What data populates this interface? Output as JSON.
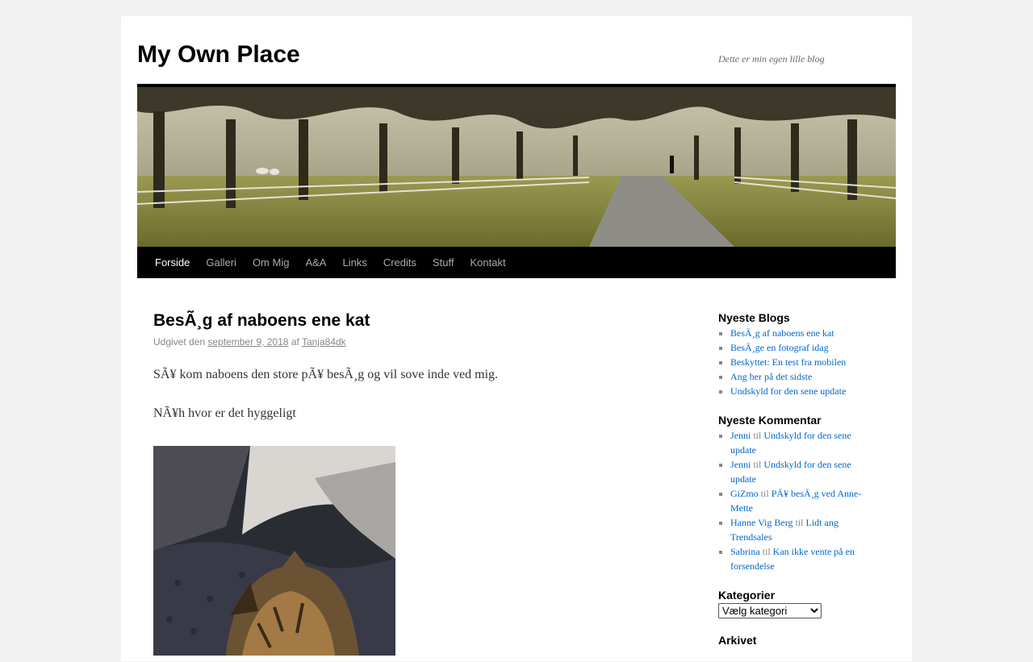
{
  "site": {
    "title": "My Own Place",
    "description": "Dette er min egen lille blog"
  },
  "nav": {
    "items": [
      {
        "label": "Forside",
        "current": true
      },
      {
        "label": "Galleri"
      },
      {
        "label": "Om Mig"
      },
      {
        "label": "A&A"
      },
      {
        "label": "Links"
      },
      {
        "label": "Credits"
      },
      {
        "label": "Stuff"
      },
      {
        "label": "Kontakt"
      }
    ]
  },
  "post": {
    "title": "BesÃ¸g af naboens ene kat",
    "meta_prefix": "Udgivet den",
    "date": "september 9, 2018",
    "by": "af",
    "author": "Tanja84dk",
    "paragraphs": [
      "SÃ¥ kom naboens den store pÃ¥ besÃ¸g og vil sove inde ved mig.",
      "NÃ¥h hvor er det hyggeligt"
    ]
  },
  "sidebar": {
    "recent_posts": {
      "title": "Nyeste Blogs",
      "items": [
        "BesÃ¸g af naboens ene kat",
        "BesÃ¸ge en fotograf idag",
        "Beskyttet: En test fra mobilen",
        "Ang her på det sidste",
        "Undskyld for den sene update"
      ]
    },
    "recent_comments": {
      "title": "Nyeste Kommentar",
      "connector": "til",
      "items": [
        {
          "author": "Jenni",
          "post": "Undskyld for den sene update"
        },
        {
          "author": "Jenni",
          "post": "Undskyld for den sene update"
        },
        {
          "author": "GiZmo",
          "post": "PÃ¥ besÃ¸g ved Anne-Mette"
        },
        {
          "author": "Hanne Vig Berg",
          "post": "Lidt ang Trendsales"
        },
        {
          "author": "Sabrina",
          "post": "Kan ikke vente på en forsendelse"
        }
      ]
    },
    "categories": {
      "title": "Kategorier",
      "selected": "Vælg kategori"
    },
    "archive": {
      "title": "Arkivet"
    }
  },
  "colors": {
    "link": "#0066cc",
    "nav_bg": "#000000",
    "page_bg": "#f1f1f1"
  }
}
